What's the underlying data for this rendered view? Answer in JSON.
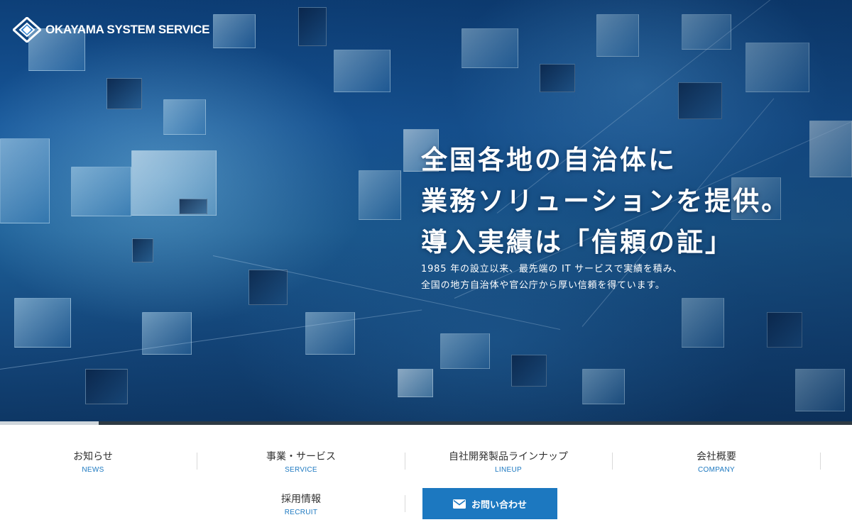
{
  "brand": {
    "name": "OKAYAMA SYSTEM SERVICE"
  },
  "hero": {
    "headline": [
      "全国各地の自治体に",
      "業務ソリューションを提供。",
      "導入実績は「信頼の証」"
    ],
    "subcopy": [
      "1985 年の設立以来、最先端の IT サービスで実績を積み、",
      "全国の地方自治体や官公庁から厚い信頼を得ています。"
    ],
    "slider_progress": 0.116
  },
  "nav": {
    "items": [
      {
        "ja": "お知らせ",
        "en": "NEWS"
      },
      {
        "ja": "事業・サービス",
        "en": "SERVICE"
      },
      {
        "ja": "自社開発製品ラインナップ",
        "en": "LINEUP"
      },
      {
        "ja": "会社概要",
        "en": "COMPANY"
      },
      {
        "ja": "採用情報",
        "en": "RECRUIT"
      }
    ],
    "contact": {
      "label": "お問い合わせ",
      "icon": "mail-icon"
    }
  },
  "colors": {
    "accent": "#1c78c0",
    "hero_deep": "#0e3765",
    "text": "#333333"
  }
}
